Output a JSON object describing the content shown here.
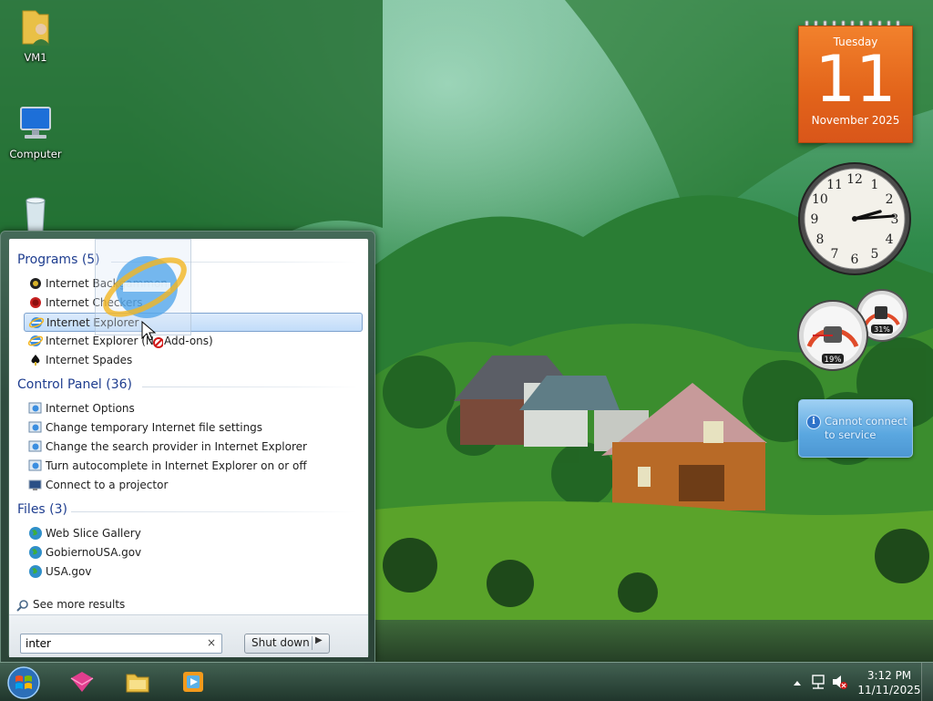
{
  "desktop": {
    "icons": [
      {
        "label": "VM1",
        "icon": "user-folder-icon"
      },
      {
        "label": "Computer",
        "icon": "computer-icon"
      },
      {
        "label": "Recycle Bin",
        "icon": "recycle-bin-icon"
      }
    ]
  },
  "gadgets": {
    "calendar": {
      "weekday": "Tuesday",
      "day": "11",
      "month_year": "November 2025"
    },
    "clock": {
      "numerals": [
        "12",
        "1",
        "2",
        "3",
        "4",
        "5",
        "6",
        "7",
        "8",
        "9",
        "10",
        "11"
      ],
      "time": "3:12"
    },
    "meters": {
      "cpu_percent": 19,
      "memory_percent": 31,
      "cpu_label": "19%",
      "memory_label": "31%"
    },
    "weather": {
      "message_line1": "Cannot connect",
      "message_line2": "to service"
    }
  },
  "start_menu": {
    "categories": [
      {
        "title": "Programs (5)",
        "items": [
          {
            "label": "Internet Backgammon",
            "icon": "backgammon-icon"
          },
          {
            "label": "Internet Checkers",
            "icon": "checkers-icon"
          },
          {
            "label": "Internet Explorer",
            "icon": "internet-explorer-icon",
            "selected": true
          },
          {
            "label": "Internet Explorer (No Add-ons)",
            "icon": "internet-explorer-icon"
          },
          {
            "label": "Internet Spades",
            "icon": "spades-icon"
          }
        ]
      },
      {
        "title": "Control Panel (36)",
        "items": [
          {
            "label": "Internet Options",
            "icon": "internet-options-icon"
          },
          {
            "label": "Change temporary Internet file settings",
            "icon": "internet-options-icon"
          },
          {
            "label": "Change the search provider in Internet Explorer",
            "icon": "internet-options-icon"
          },
          {
            "label": "Turn autocomplete in Internet Explorer on or off",
            "icon": "internet-options-icon"
          },
          {
            "label": "Connect to a projector",
            "icon": "projector-icon"
          }
        ]
      },
      {
        "title": "Files (3)",
        "items": [
          {
            "label": "Web Slice Gallery",
            "icon": "globe-icon"
          },
          {
            "label": "GobiernoUSA.gov",
            "icon": "globe-icon"
          },
          {
            "label": "USA.gov",
            "icon": "globe-icon"
          }
        ]
      }
    ],
    "see_more": "See more results",
    "search": {
      "value": "inter",
      "clear": "×"
    },
    "shutdown": {
      "label": "Shut down",
      "arrow": "▶"
    }
  },
  "taskbar": {
    "pinned": [
      {
        "name": "app-pinned-1",
        "icon": "pink-app-icon"
      },
      {
        "name": "windows-explorer",
        "icon": "folder-icon"
      },
      {
        "name": "media-player",
        "icon": "media-player-icon"
      }
    ],
    "clock": {
      "time": "3:12 PM",
      "date": "11/11/2025"
    }
  },
  "colors": {
    "calendar": "#e2631a",
    "category_heading": "#1e3d8f",
    "selection": "#c1dcf9",
    "weather": "#5aa7e0"
  }
}
